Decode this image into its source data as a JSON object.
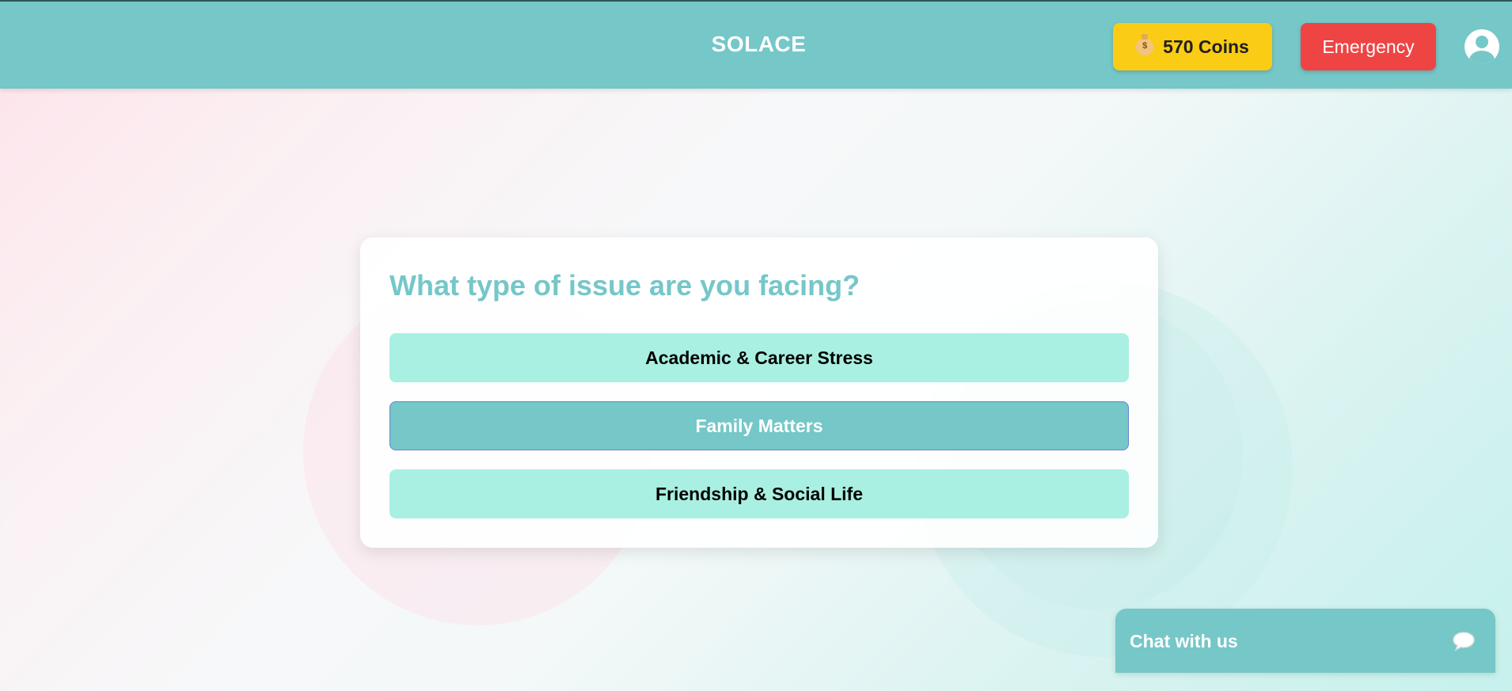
{
  "header": {
    "brand": "SOLACE",
    "coins_label": "570 Coins",
    "coins_icon": "money-bag-icon",
    "emergency_label": "Emergency",
    "avatar_icon": "user-avatar-icon"
  },
  "card": {
    "title": "What type of issue are you facing?",
    "options": [
      {
        "label": "Academic & Career Stress"
      },
      {
        "label": "Family Matters",
        "selected": true
      },
      {
        "label": "Friendship & Social Life"
      }
    ]
  },
  "chat": {
    "label": "Chat with us",
    "icon": "chat-bubble-icon"
  },
  "colors": {
    "brand_teal": "#75c7c8",
    "coins_yellow": "#facc15",
    "emergency_red": "#ef4444",
    "option_mint": "#a9f0e2"
  }
}
